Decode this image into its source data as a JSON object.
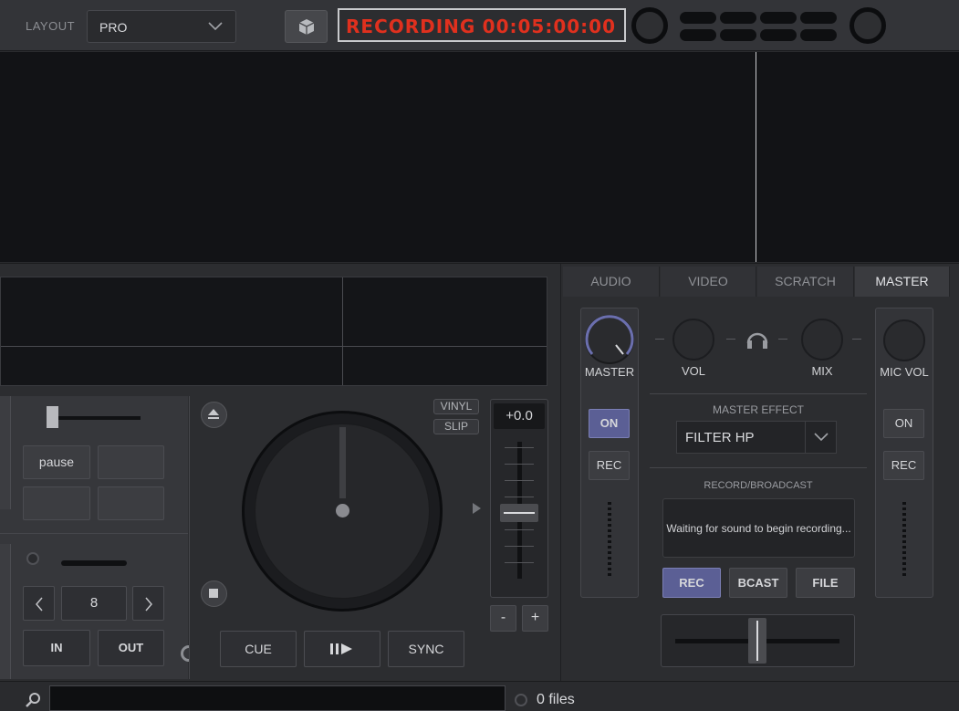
{
  "topbar": {
    "layout_label": "LAYOUT",
    "layout_value": "PRO",
    "recording_label": "RECORDING",
    "recording_time": "00:05:00:00"
  },
  "deck": {
    "pause_label": "pause",
    "loop_value": "8",
    "in_label": "IN",
    "out_label": "OUT",
    "vinyl_label": "VINYL",
    "slip_label": "SLIP",
    "pitch_value": "+0.0",
    "pitch_minus": "-",
    "pitch_plus": "+",
    "cue_label": "CUE",
    "sync_label": "SYNC"
  },
  "tabs": [
    "AUDIO",
    "VIDEO",
    "SCRATCH",
    "MASTER"
  ],
  "master": {
    "master_label": "MASTER",
    "vol_label": "VOL",
    "mix_label": "MIX",
    "micvol_label": "MIC VOL",
    "on_label": "ON",
    "rec_label": "REC",
    "mic_on_label": "ON",
    "mic_rec_label": "REC",
    "effect_title": "MASTER EFFECT",
    "effect_value": "FILTER HP",
    "record_title": "RECORD/BROADCAST",
    "record_status": "Waiting for sound to begin recording...",
    "rec_button": "REC",
    "bcast_button": "BCAST",
    "file_button": "FILE"
  },
  "browser": {
    "search_placeholder": "",
    "file_count": "0 files"
  }
}
